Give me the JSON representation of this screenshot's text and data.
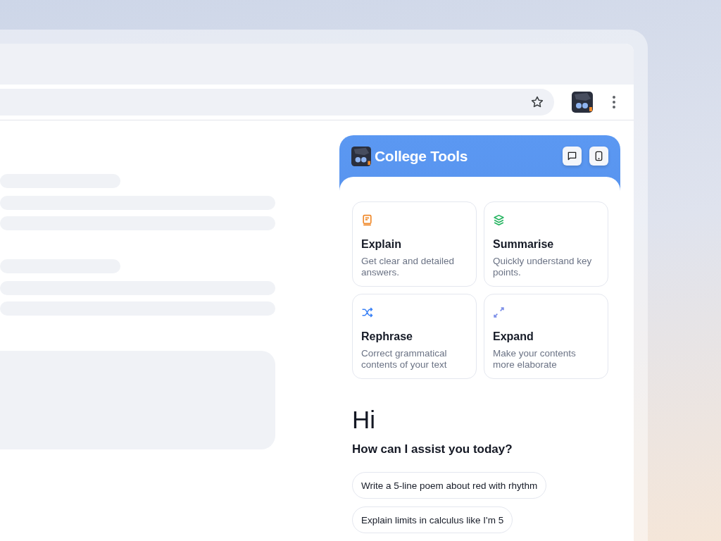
{
  "page_placeholder": [
    {
      "kind": "short"
    },
    {
      "kind": "long"
    },
    {
      "kind": "long"
    },
    {
      "kind": "gap"
    },
    {
      "kind": "short"
    },
    {
      "kind": "long"
    },
    {
      "kind": "long"
    },
    {
      "kind": "gap"
    },
    {
      "kind": "block"
    }
  ],
  "panel": {
    "title": "College Tools",
    "tools": [
      {
        "title": "Explain",
        "description": "Get clear and detailed answers.",
        "color": "#f08a2c"
      },
      {
        "title": "Summarise",
        "description": "Quickly understand key points.",
        "color": "#22b35e"
      },
      {
        "title": "Rephrase",
        "description": "Correct grammatical contents of your text",
        "color": "#3b82f6"
      },
      {
        "title": "Expand",
        "description": "Make your contents more elaborate",
        "color": "#7c8fe8"
      }
    ],
    "greeting": "Hi",
    "question": "How can I assist you today?",
    "suggestions": [
      "Write a 5-line poem about red with rhythm",
      "Explain limits in calculus like I'm 5"
    ]
  }
}
